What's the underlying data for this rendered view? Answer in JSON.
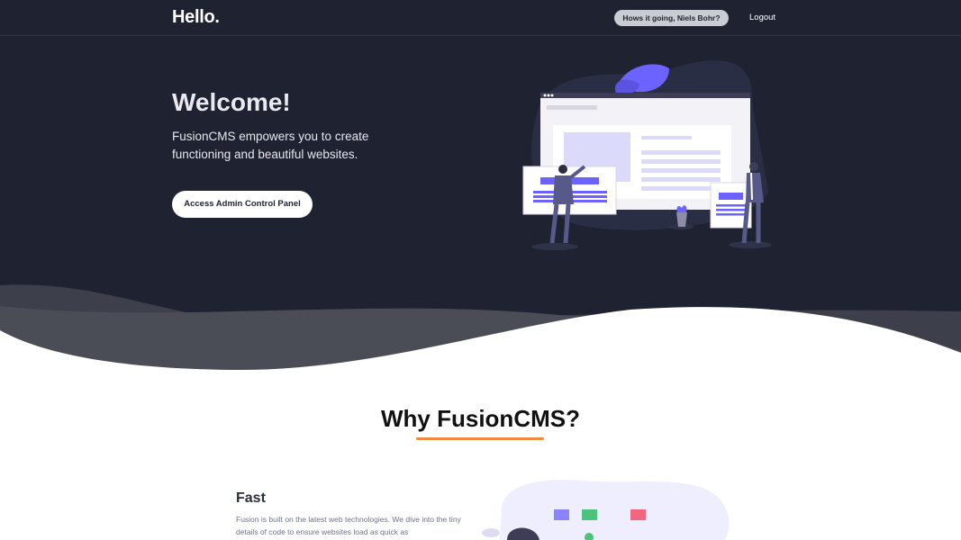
{
  "header": {
    "brand": "Hello.",
    "greeting": "Hows it going, Niels Bohr?",
    "logout": "Logout"
  },
  "hero": {
    "heading": "Welcome!",
    "subtitle": "FusionCMS empowers you to create functioning and beautiful websites.",
    "cta_label": "Access Admin Control Panel"
  },
  "why": {
    "title": "Why FusionCMS?"
  },
  "features": [
    {
      "title": "Fast",
      "description": "Fusion is built on the latest web technologies. We dive into the tiny details of code to ensure websites load as quick as"
    }
  ],
  "colors": {
    "hero_background": "#1f2230",
    "accent_underline": "#f08a3e",
    "illustration_purple": "#6c63ff",
    "illustration_green": "#4cc37a",
    "illustration_pink": "#f2677d"
  }
}
